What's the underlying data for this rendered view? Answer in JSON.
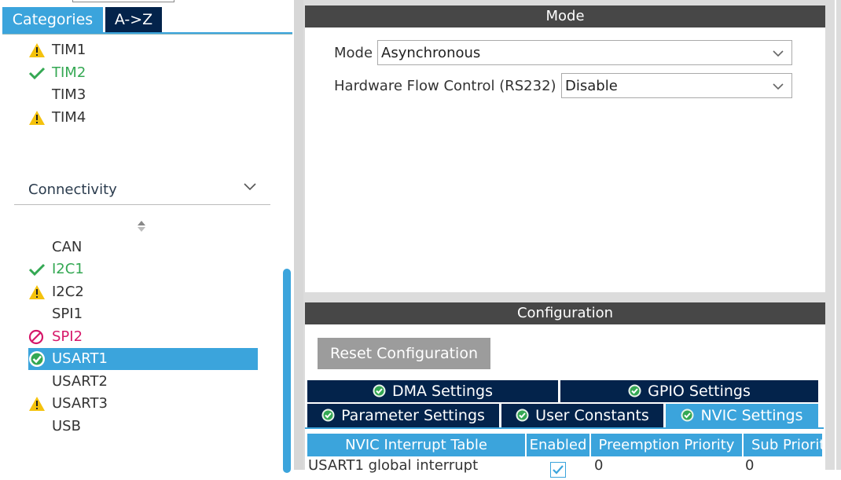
{
  "tabs": {
    "categories": "Categories",
    "az": "A->Z"
  },
  "timers": [
    {
      "label": "TIM1",
      "status": "warning"
    },
    {
      "label": "TIM2",
      "status": "ok"
    },
    {
      "label": "TIM3",
      "status": "none"
    },
    {
      "label": "TIM4",
      "status": "warning"
    }
  ],
  "connectivity": {
    "title": "Connectivity",
    "items": [
      {
        "label": "CAN",
        "status": "none"
      },
      {
        "label": "I2C1",
        "status": "ok"
      },
      {
        "label": "I2C2",
        "status": "warning"
      },
      {
        "label": "SPI1",
        "status": "none"
      },
      {
        "label": "SPI2",
        "status": "blocked"
      },
      {
        "label": "USART1",
        "status": "selected"
      },
      {
        "label": "USART2",
        "status": "none"
      },
      {
        "label": "USART3",
        "status": "warning"
      },
      {
        "label": "USB",
        "status": "none"
      }
    ]
  },
  "mode_panel": {
    "title": "Mode",
    "mode_label": "Mode",
    "mode_value": "Asynchronous",
    "flow_label": "Hardware Flow Control (RS232)",
    "flow_value": "Disable"
  },
  "config_panel": {
    "title": "Configuration",
    "reset_label": "Reset Configuration",
    "tabs_row1": [
      "DMA Settings",
      "GPIO Settings"
    ],
    "tabs_row2": [
      "Parameter Settings",
      "User Constants",
      "NVIC Settings"
    ],
    "active_tab": "NVIC Settings",
    "table": {
      "headers": [
        "NVIC Interrupt Table",
        "Enabled",
        "Preemption Priority",
        "Sub Priorit"
      ],
      "rows": [
        {
          "name": "USART1 global interrupt",
          "enabled": true,
          "preemption": "0",
          "sub": "0"
        }
      ]
    }
  },
  "colors": {
    "accent": "#3ba4dc",
    "navy": "#03234b",
    "ok": "#34a853",
    "warning": "#f4c20d",
    "error": "#d6186a",
    "header": "#474747"
  }
}
